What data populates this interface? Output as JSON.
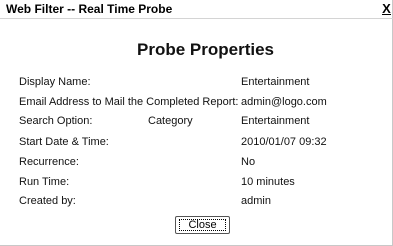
{
  "window": {
    "title": "Web Filter -- Real Time Probe",
    "close_glyph": "X"
  },
  "dialog": {
    "heading": "Probe Properties",
    "fields": [
      {
        "label": "Display Name:",
        "value": "Entertainment"
      },
      {
        "label": "Email Address to Mail the Completed Report:",
        "value": "admin@logo.com"
      },
      {
        "label": "Search Option:",
        "option": "Category",
        "value": "Entertainment"
      },
      {
        "label": "Start Date & Time:",
        "value": "2010/01/07 09:32"
      },
      {
        "label": "Recurrence:",
        "value": "No"
      },
      {
        "label": "Run Time:",
        "value": "10 minutes"
      },
      {
        "label": "Created by:",
        "value": "admin"
      }
    ],
    "close_button_label": "Close"
  }
}
